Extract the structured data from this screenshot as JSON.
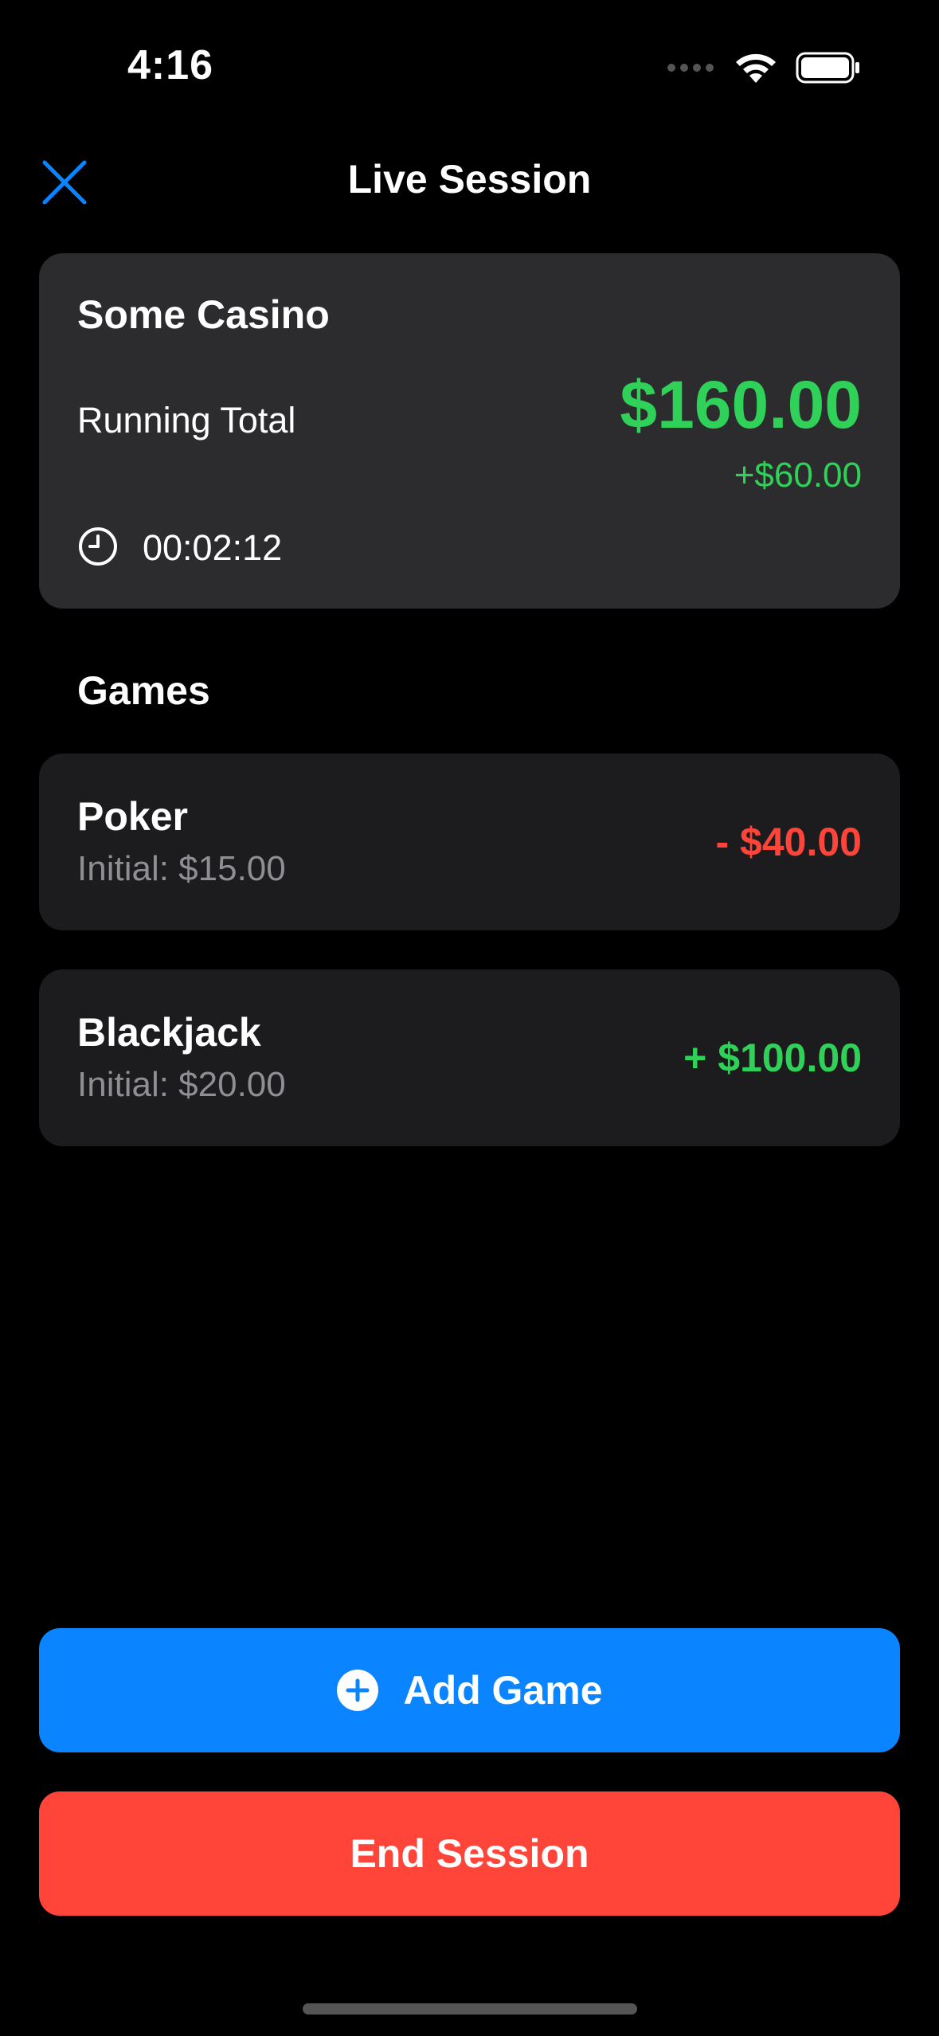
{
  "status_bar": {
    "time": "4:16",
    "icons": [
      "cellular-dots-icon",
      "wifi-icon",
      "battery-icon"
    ]
  },
  "nav": {
    "title": "Live Session",
    "close_icon": "close-icon"
  },
  "session": {
    "casino_name": "Some Casino",
    "running_total_label": "Running Total",
    "running_total": "$160.00",
    "running_delta": "+$60.00",
    "elapsed": "00:02:12",
    "clock_icon": "clock-icon"
  },
  "games_section": {
    "title": "Games",
    "games": [
      {
        "name": "Poker",
        "initial": "Initial: $15.00",
        "amount": "- $40.00"
      },
      {
        "name": "Blackjack",
        "initial": "Initial: $20.00",
        "amount": "+ $100.00"
      }
    ]
  },
  "actions": {
    "add_game_label": "Add Game",
    "end_session_label": "End Session"
  },
  "colors": {
    "accent_blue": "#0a84ff",
    "positive_green": "#30d158",
    "negative_red": "#ff453a",
    "card_bg": "#2c2c2e",
    "game_card_bg": "#1c1c1e"
  }
}
